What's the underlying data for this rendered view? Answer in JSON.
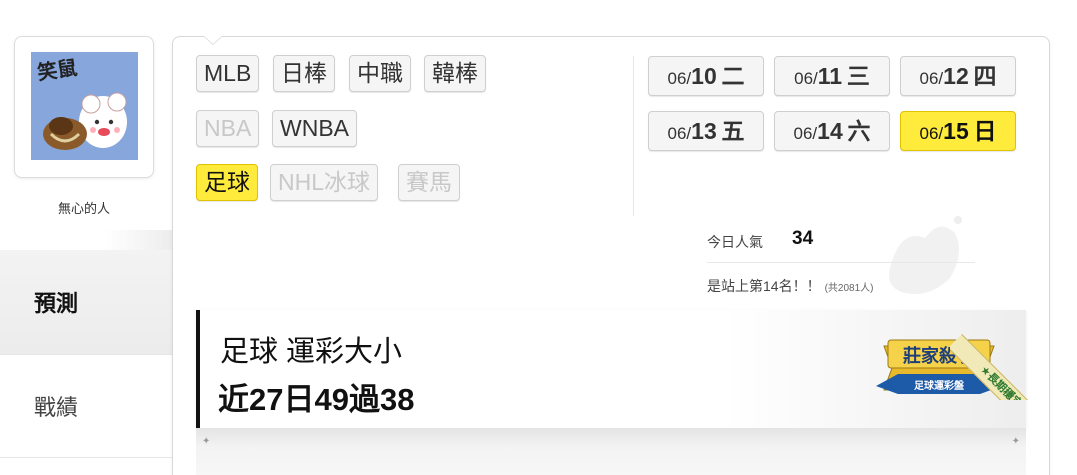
{
  "profile": {
    "avatar_caption": "笑鼠",
    "username": "無心的人"
  },
  "side_nav": {
    "items": [
      {
        "label": "預測",
        "active": true
      },
      {
        "label": "戰績",
        "active": false
      }
    ]
  },
  "sport_filters": {
    "rows": [
      [
        {
          "label": "MLB",
          "state": "normal"
        },
        {
          "label": "日棒",
          "state": "normal"
        },
        {
          "label": "中職",
          "state": "normal"
        },
        {
          "label": "韓棒",
          "state": "normal"
        }
      ],
      [
        {
          "label": "NBA",
          "state": "disabled"
        },
        {
          "label": "WNBA",
          "state": "normal"
        }
      ],
      [
        {
          "label": "足球",
          "state": "active"
        },
        {
          "label": "NHL冰球",
          "state": "disabled"
        },
        {
          "label": "賽馬",
          "state": "disabled"
        }
      ]
    ]
  },
  "dates": [
    {
      "month": "06/",
      "day": "10",
      "weekday": "二",
      "selected": false
    },
    {
      "month": "06/",
      "day": "11",
      "weekday": "三",
      "selected": false
    },
    {
      "month": "06/",
      "day": "12",
      "weekday": "四",
      "selected": false
    },
    {
      "month": "06/",
      "day": "13",
      "weekday": "五",
      "selected": false
    },
    {
      "month": "06/",
      "day": "14",
      "weekday": "六",
      "selected": false
    },
    {
      "month": "06/",
      "day": "15",
      "weekday": "日",
      "selected": true
    }
  ],
  "popularity": {
    "label": "今日人氣",
    "value": "34",
    "rank_text": "是站上第14名！！",
    "rank_total": "(共2081人)"
  },
  "prediction_card": {
    "type": "足球 運彩大小",
    "record": "近27日49過38"
  },
  "badge": {
    "title": "莊家殺手",
    "subtitle": "足球運彩盤",
    "ribbon": "★長期穩定★"
  },
  "colors": {
    "accent_yellow": "#ffeb3b",
    "badge_blue": "#1d5aa8",
    "badge_gold": "#e8b92b"
  }
}
